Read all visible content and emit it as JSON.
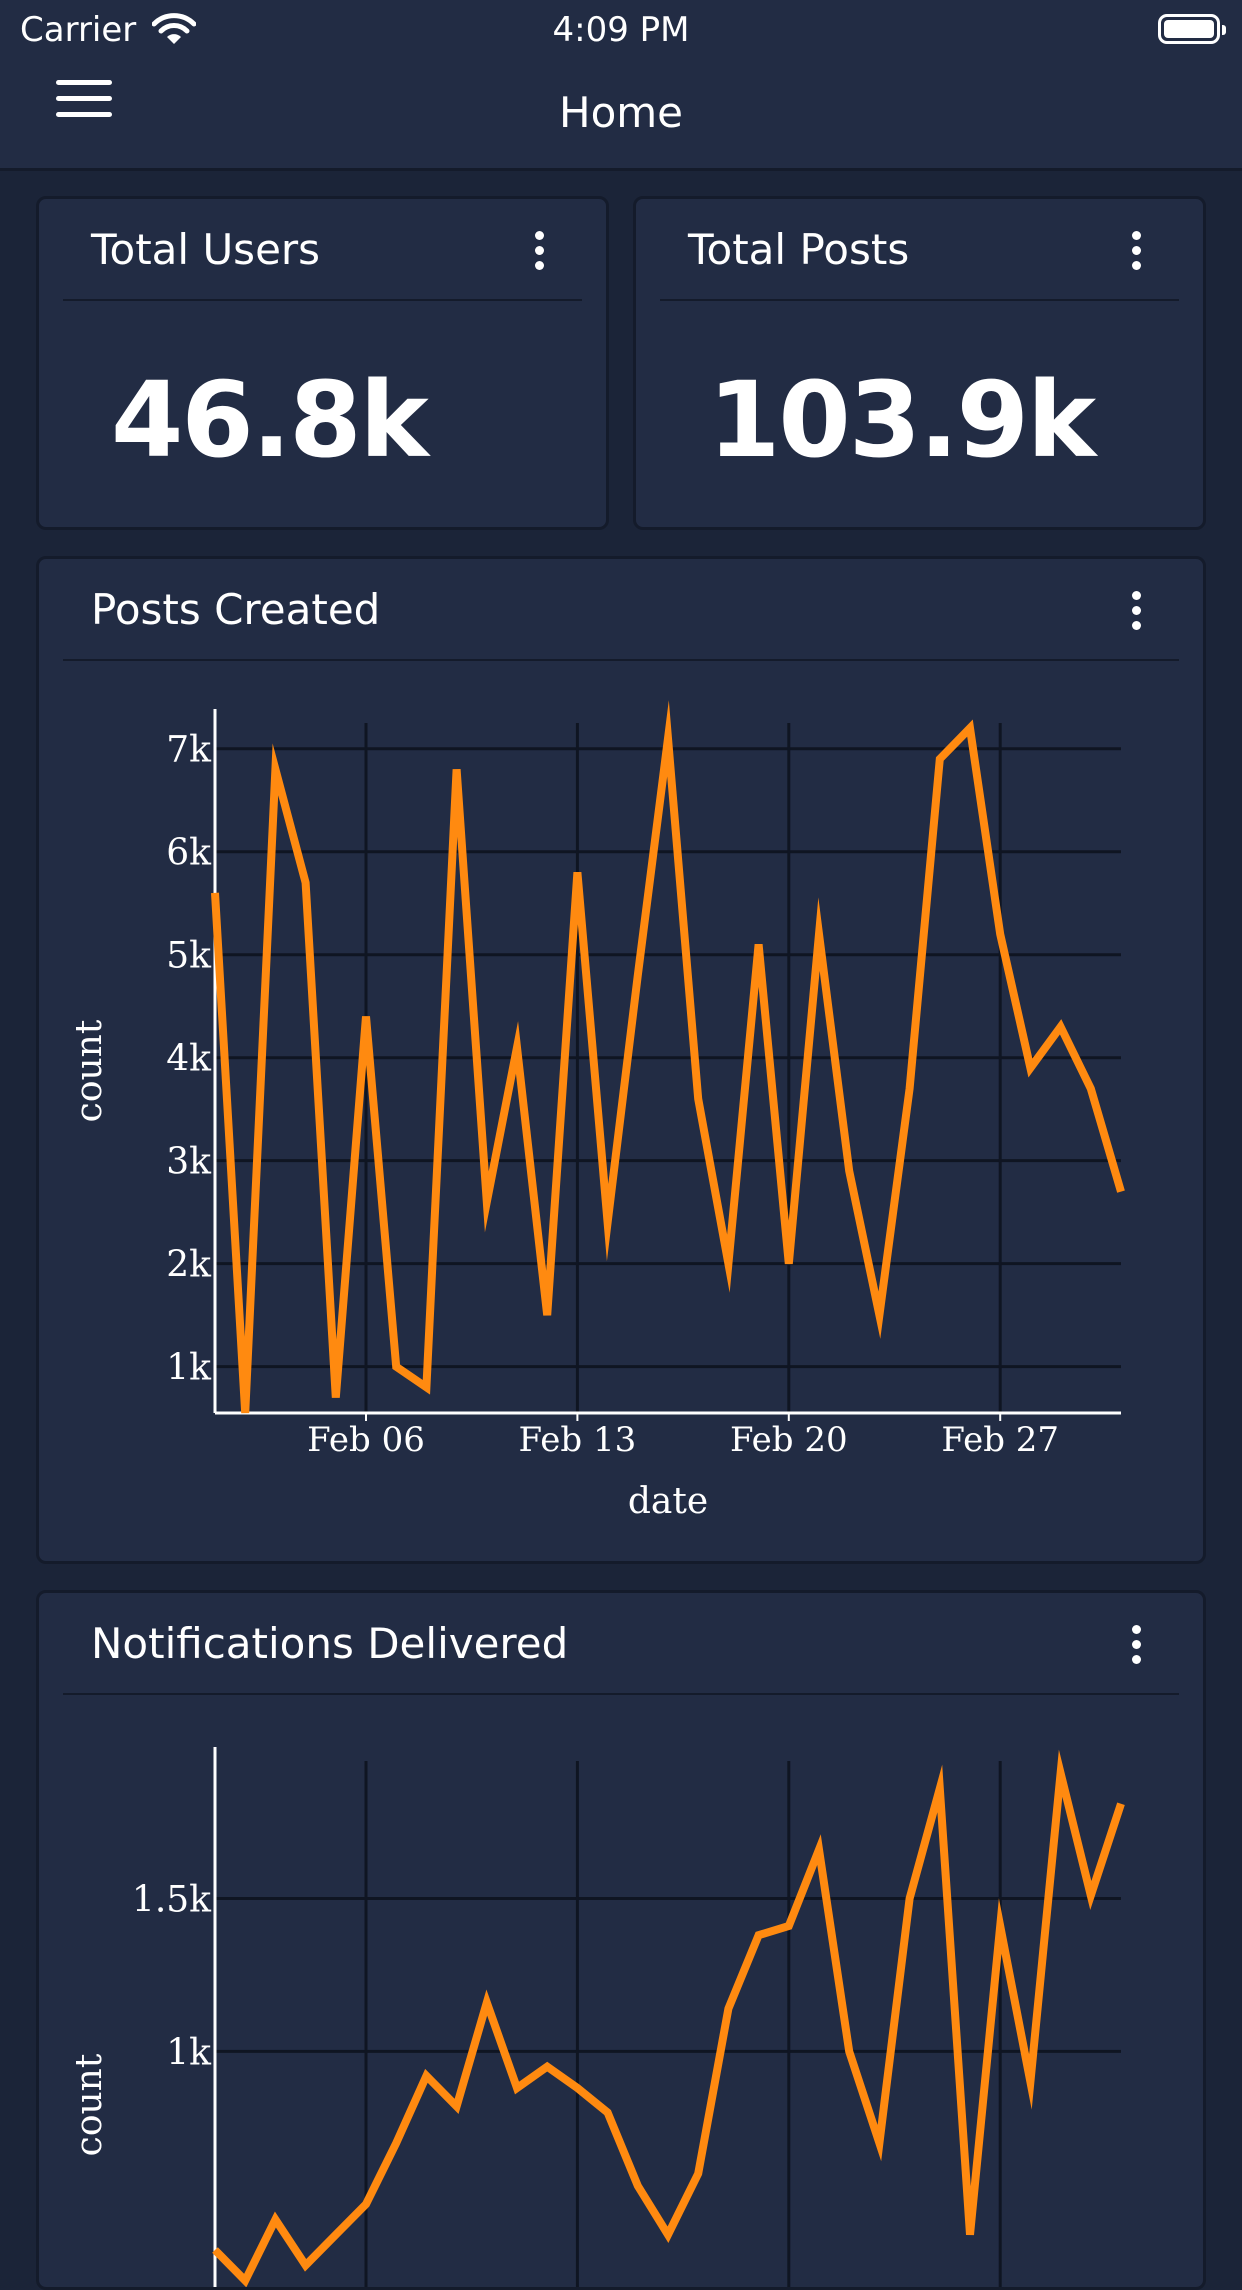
{
  "status_bar": {
    "carrier": "Carrier",
    "time": "4:09 PM"
  },
  "nav": {
    "title": "Home"
  },
  "stats": [
    {
      "title": "Total Users",
      "value": "46.8k"
    },
    {
      "title": "Total Posts",
      "value": "103.9k"
    }
  ],
  "charts": [
    {
      "title": "Posts Created"
    },
    {
      "title": "Notifications Delivered"
    }
  ],
  "colors": {
    "background": "#1b2438",
    "card": "#222c44",
    "line": "#ff8a10"
  },
  "chart_data": [
    {
      "type": "line",
      "title": "Posts Created",
      "xlabel": "date",
      "ylabel": "count",
      "x_ticks": [
        "Feb 06",
        "Feb 13",
        "Feb 20",
        "Feb 27"
      ],
      "y_ticks": [
        "1k",
        "2k",
        "3k",
        "4k",
        "5k",
        "6k",
        "7k"
      ],
      "ylim": [
        550,
        7250
      ],
      "grid": true,
      "series": [
        {
          "x": [
            "2022-02-01",
            "2022-02-02",
            "2022-02-03",
            "2022-02-04",
            "2022-02-05",
            "2022-02-06",
            "2022-02-07",
            "2022-02-08",
            "2022-02-09",
            "2022-02-10",
            "2022-02-11",
            "2022-02-12",
            "2022-02-13",
            "2022-02-14",
            "2022-02-15",
            "2022-02-16",
            "2022-02-17",
            "2022-02-18",
            "2022-02-19",
            "2022-02-20",
            "2022-02-21",
            "2022-02-22",
            "2022-02-23",
            "2022-02-24",
            "2022-02-25",
            "2022-02-26",
            "2022-02-27",
            "2022-02-28",
            "2022-03-01",
            "2022-03-02",
            "2022-03-03"
          ],
          "values": [
            5600,
            550,
            6800,
            5700,
            700,
            4400,
            1000,
            800,
            6800,
            2600,
            4100,
            1500,
            5800,
            2400,
            4800,
            7100,
            3600,
            2000,
            5100,
            2000,
            5200,
            2900,
            1500,
            3700,
            6900,
            7200,
            5200,
            3900,
            4300,
            3700,
            2700
          ]
        }
      ]
    },
    {
      "type": "line",
      "title": "Notifications Delivered",
      "ylabel": "count",
      "y_ticks": [
        "1k",
        "1.5k"
      ],
      "ylim": [
        0,
        1950
      ],
      "grid": true,
      "series": [
        {
          "x": [
            "2022-02-01",
            "2022-02-02",
            "2022-02-03",
            "2022-02-04",
            "2022-02-05",
            "2022-02-06",
            "2022-02-07",
            "2022-02-08",
            "2022-02-09",
            "2022-02-10",
            "2022-02-11",
            "2022-02-12",
            "2022-02-13",
            "2022-02-14",
            "2022-02-15",
            "2022-02-16",
            "2022-02-17",
            "2022-02-18",
            "2022-02-19",
            "2022-02-20",
            "2022-02-21",
            "2022-02-22",
            "2022-02-23",
            "2022-02-24",
            "2022-02-25",
            "2022-02-26",
            "2022-02-27",
            "2022-02-28",
            "2022-03-01",
            "2022-03-02",
            "2022-03-03"
          ],
          "values": [
            350,
            250,
            450,
            300,
            400,
            500,
            700,
            920,
            820,
            1160,
            880,
            950,
            880,
            800,
            560,
            400,
            600,
            1140,
            1380,
            1410,
            1660,
            1000,
            700,
            1500,
            1860,
            400,
            1410,
            900,
            1910,
            1510,
            1810
          ]
        }
      ]
    }
  ]
}
